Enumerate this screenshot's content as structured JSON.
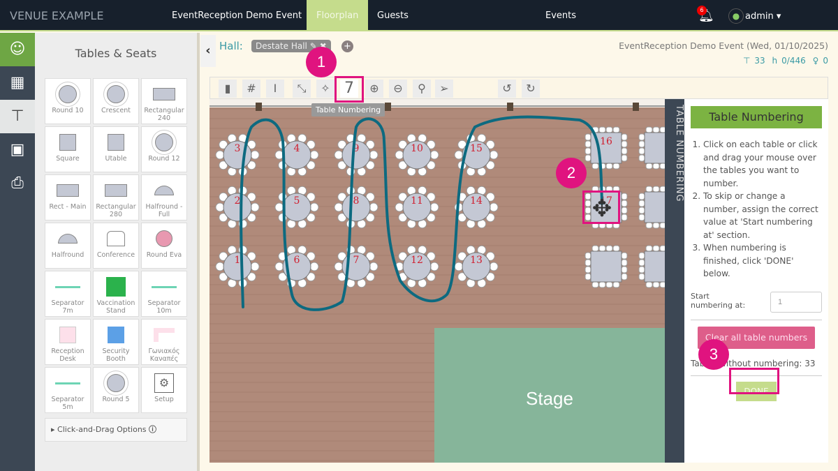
{
  "topbar": {
    "brand": "VENUE EXAMPLE",
    "nav": [
      "EventReception Demo Event",
      "Floorplan",
      "Guests",
      "Events"
    ],
    "notifications": "6",
    "user": "admin ▾"
  },
  "rail": {
    "icons": [
      "guests-icon",
      "layout-icon",
      "table-icon",
      "chair-icon",
      "print-icon"
    ]
  },
  "panel": {
    "title": "Tables & Seats",
    "items": [
      "Round 10",
      "Crescent",
      "Rectangular 240",
      "Square",
      "Utable",
      "Round 12",
      "Rect - Main",
      "Rectangular 280",
      "Halfround - Full",
      "Halfround",
      "Conference",
      "Round Eva",
      "Separator 7m",
      "Vaccination Stand",
      "Separator 10m",
      "Reception Desk",
      "Security Booth",
      "Γωνιακός Καναπές",
      "Separator 5m",
      "Round 5",
      "Setup"
    ],
    "click_drag": "Click-and-Drag Options"
  },
  "hall": {
    "label": "Hall:",
    "name": "Destate Hall ✎ ✖",
    "add": "+"
  },
  "event": {
    "title": "EventReception Demo Event (Wed, 01/10/2025)",
    "tables": "33",
    "seats": "0/446",
    "guests": "0"
  },
  "toolbar": {
    "tooltip": "Table Numbering",
    "numbering_glyph": "7"
  },
  "floor": {
    "round_tables": [
      [
        "3",
        "2",
        "1"
      ],
      [
        "4",
        "5",
        "6"
      ],
      [
        "9",
        "8",
        "7"
      ],
      [
        "10",
        "11",
        "12"
      ],
      [
        "15",
        "14",
        "13"
      ]
    ],
    "square_tables": [
      "16",
      "17",
      ""
    ],
    "stage": "Stage",
    "colors": {
      "floor": "#b08a7a",
      "stage": "#86b59a",
      "path": "#0d6a80"
    }
  },
  "sidebar": {
    "tab": "TABLE NUMBERING",
    "title": "Table Numbering",
    "steps": [
      "Click on each table or click and drag your mouse over the tables you want to number.",
      "To skip or change a number, assign the correct value at 'Start numbering at' section.",
      "When numbering is finished, click 'DONE' below."
    ],
    "start_label": "Start numbering at:",
    "start_value": "1",
    "clear": "Clear all table numbers",
    "without": "Tables without numbering: 33",
    "done": "DONE"
  },
  "markers": [
    "1",
    "2",
    "3"
  ],
  "accent": "#e0137f"
}
